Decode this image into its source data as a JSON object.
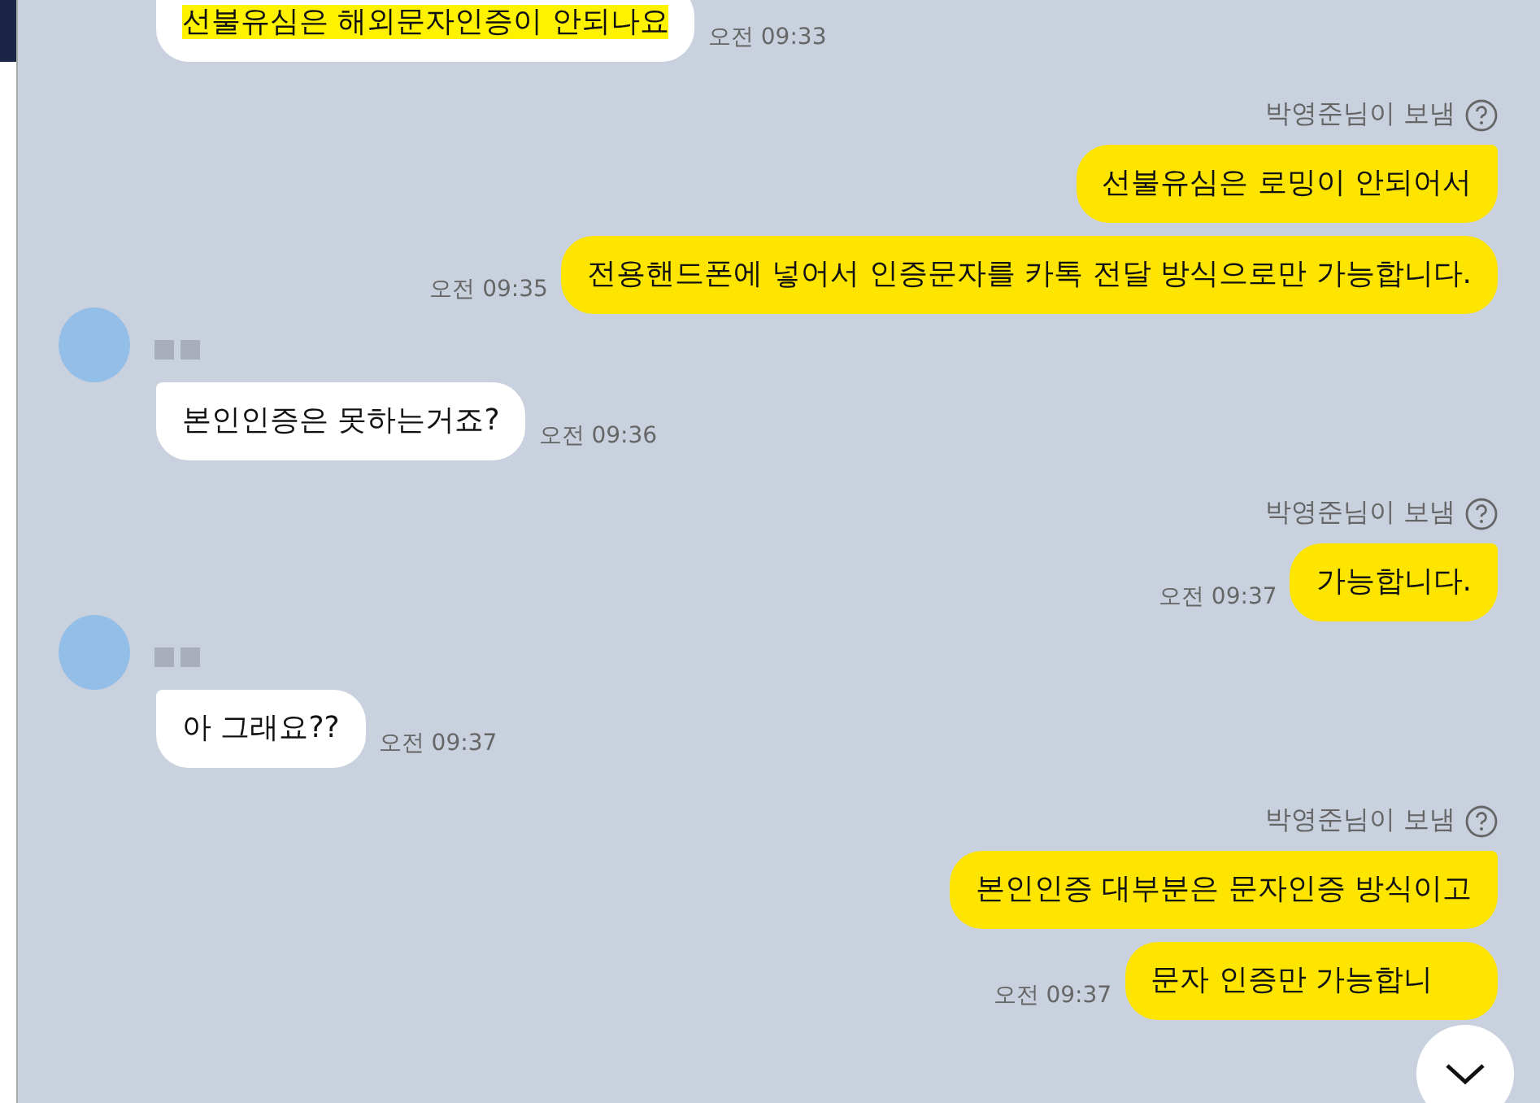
{
  "messages": [
    {
      "kind": "received",
      "show_profile": false,
      "bubbles": [
        {
          "text": "선불유심은 해외문자인증이 안되나요",
          "highlighted": true
        }
      ],
      "time": "오전 09:33"
    },
    {
      "kind": "sent",
      "sender_note": "박영준님이 보냄",
      "bubbles": [
        {
          "text": "선불유심은 로밍이 안되어서",
          "highlighted": false
        },
        {
          "text": "전용핸드폰에 넣어서 인증문자를 카톡 전달 방식으로만 가능합니다.",
          "highlighted": false
        }
      ],
      "time": "오전 09:35"
    },
    {
      "kind": "received",
      "show_profile": true,
      "bubbles": [
        {
          "text": "본인인증은 못하는거죠?",
          "highlighted": false
        }
      ],
      "time": "오전 09:36"
    },
    {
      "kind": "sent",
      "sender_note": "박영준님이 보냄",
      "bubbles": [
        {
          "text": "가능합니다.",
          "highlighted": false
        }
      ],
      "time": "오전 09:37"
    },
    {
      "kind": "received",
      "show_profile": true,
      "bubbles": [
        {
          "text": "아 그래요??",
          "highlighted": false
        }
      ],
      "time": "오전 09:37"
    },
    {
      "kind": "sent",
      "sender_note": "박영준님이 보냄",
      "bubbles": [
        {
          "text": "본인인증 대부분은 문자인증 방식이고",
          "highlighted": false
        },
        {
          "text": "문자 인증만 가능합니",
          "highlighted": false
        }
      ],
      "time": "오전 09:37"
    }
  ]
}
